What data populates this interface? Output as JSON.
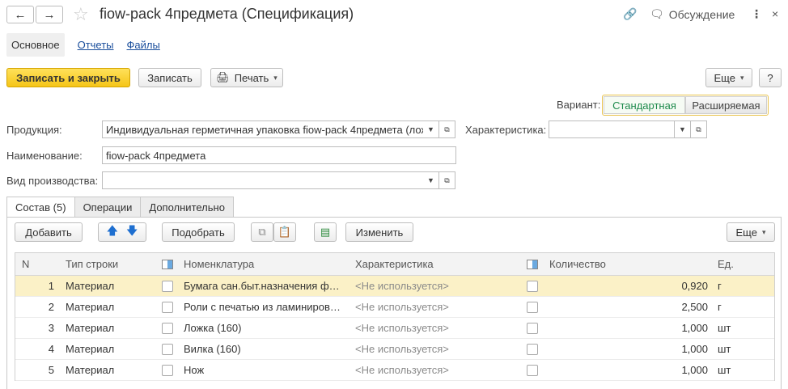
{
  "header": {
    "title": "fiow-pack 4предмета (Спецификация)",
    "discussion": "Обсуждение"
  },
  "tabs_top": {
    "main": "Основное",
    "reports": "Отчеты",
    "files": "Файлы"
  },
  "toolbar": {
    "save_close": "Записать и закрыть",
    "save": "Записать",
    "print": "Печать",
    "more": "Еще",
    "help": "?"
  },
  "variant": {
    "label": "Вариант:",
    "option_standard": "Стандартная",
    "option_extended": "Расширяемая"
  },
  "form": {
    "product_label": "Продукция:",
    "product_value": "Индивидуальная герметичная упаковка fiow-pack 4предмета (лож",
    "characteristic_label": "Характеристика:",
    "characteristic_value": "",
    "name_label": "Наименование:",
    "name_value": "fiow-pack 4предмета",
    "production_type_label": "Вид производства:",
    "production_type_value": ""
  },
  "panel_tabs": {
    "composition": "Состав (5)",
    "operations": "Операции",
    "additional": "Дополнительно"
  },
  "table_toolbar": {
    "add": "Добавить",
    "pick": "Подобрать",
    "change": "Изменить",
    "more": "Еще"
  },
  "table": {
    "headers": {
      "n": "N",
      "row_type": "Тип строки",
      "nomenclature": "Номенклатура",
      "characteristic": "Характеристика",
      "quantity": "Количество",
      "unit": "Ед."
    },
    "rows": [
      {
        "n": "1",
        "type": "Материал",
        "nom": "Бумага сан.быт.назначения ф…",
        "char": "<Не используется>",
        "qty": "0,920",
        "unit": "г"
      },
      {
        "n": "2",
        "type": "Материал",
        "nom": "Роли с печатью из ламиниров…",
        "char": "<Не используется>",
        "qty": "2,500",
        "unit": "г"
      },
      {
        "n": "3",
        "type": "Материал",
        "nom": "Ложка (160)",
        "char": "<Не используется>",
        "qty": "1,000",
        "unit": "шт"
      },
      {
        "n": "4",
        "type": "Материал",
        "nom": "Вилка (160)",
        "char": "<Не используется>",
        "qty": "1,000",
        "unit": "шт"
      },
      {
        "n": "5",
        "type": "Материал",
        "nom": "Нож",
        "char": "<Не используется>",
        "qty": "1,000",
        "unit": "шт"
      }
    ]
  },
  "colors": {
    "accent_yellow": "#f5c518",
    "variant_active_green": "#1e8a4c",
    "selected_row": "#fbf1c7"
  }
}
